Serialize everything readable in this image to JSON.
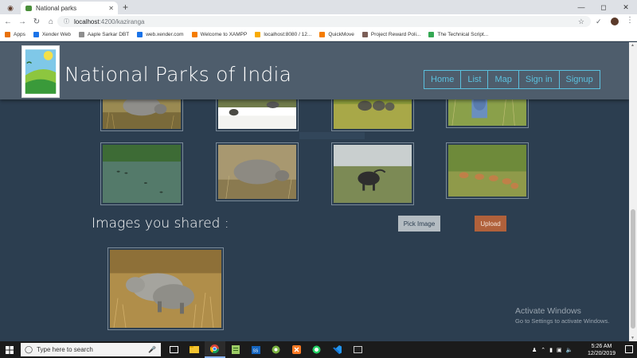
{
  "browser": {
    "tab_title": "National parks",
    "url_host": "localhost",
    "url_path": ":4200/kaziranga",
    "bookmarks": [
      {
        "label": "Apps",
        "color": "#e8710a"
      },
      {
        "label": "Xender Web",
        "color": "#1a73e8"
      },
      {
        "label": "Aaple Sarkar DBT",
        "color": "#8e8e8e"
      },
      {
        "label": "web.xender.com",
        "color": "#1a73e8"
      },
      {
        "label": "Welcome to XAMPP",
        "color": "#f57c00"
      },
      {
        "label": "localhost:8080 / 12...",
        "color": "#f9ab00"
      },
      {
        "label": "QuickMove",
        "color": "#f57c00"
      },
      {
        "label": "Project Reward Poli...",
        "color": "#7b5e57"
      },
      {
        "label": "The Technical Script...",
        "color": "#34a853"
      }
    ]
  },
  "header": {
    "title": "National Parks of India",
    "nav": [
      "Home",
      "List",
      "Map",
      "Sign in",
      "Signup"
    ]
  },
  "gallery": {
    "shared_heading": "Images you shared :",
    "pick_label": "Pick Image",
    "upload_label": "Upload"
  },
  "watermark": {
    "line1": "Activate Windows",
    "line2": "Go to Settings to activate Windows."
  },
  "taskbar": {
    "search_placeholder": "Type here to search",
    "time": "5:26 AM",
    "date": "12/20/2019"
  }
}
